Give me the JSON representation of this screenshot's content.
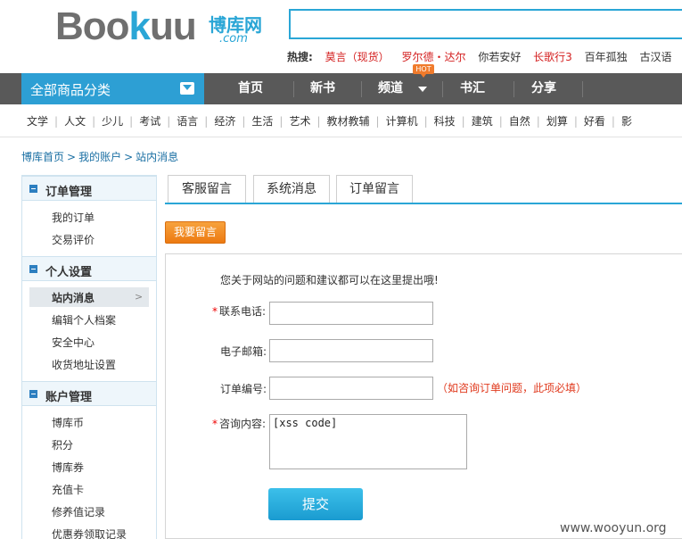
{
  "logo": {
    "word_a": "Boo",
    "word_b": "k",
    "word_c": "uu",
    "cn": "博库网",
    "com": ".com"
  },
  "search": {
    "value": ""
  },
  "hot": {
    "label": "热搜:",
    "keywords": [
      {
        "text": "莫言（现货）",
        "color": "#d42020"
      },
      {
        "text": "罗尔德・达尔",
        "color": "#d42020"
      },
      {
        "text": "你若安好",
        "color": "#333333"
      },
      {
        "text": "长歌行3",
        "color": "#d42020"
      },
      {
        "text": "百年孤独",
        "color": "#333333"
      },
      {
        "text": "古汉语",
        "color": "#333333"
      }
    ]
  },
  "nav": {
    "all_categories": "全部商品分类",
    "items": [
      "首页",
      "新书",
      "频道",
      "书汇",
      "分享"
    ],
    "hot_badge": "HOT"
  },
  "categories": [
    "文学",
    "人文",
    "少儿",
    "考试",
    "语言",
    "经济",
    "生活",
    "艺术",
    "教材教辅",
    "计算机",
    "科技",
    "建筑",
    "自然",
    "划算",
    "好看",
    "影"
  ],
  "breadcrumb": [
    "博库首页",
    "我的账户",
    "站内消息"
  ],
  "sidebar": {
    "sections": [
      {
        "title": "订单管理",
        "items": [
          "我的订单",
          "交易评价"
        ]
      },
      {
        "title": "个人设置",
        "items": [
          "站内消息",
          "编辑个人档案",
          "安全中心",
          "收货地址设置"
        ]
      },
      {
        "title": "账户管理",
        "items": [
          "博库币",
          "积分",
          "博库券",
          "充值卡",
          "修养值记录",
          "优惠券领取记录"
        ]
      }
    ]
  },
  "tabs": [
    "客服留言",
    "系统消息",
    "订单留言"
  ],
  "leave_message_button": "我要留言",
  "form": {
    "intro": "您关于网站的问题和建议都可以在这里提出哦!",
    "phone_label": "联系电话:",
    "email_label": "电子邮箱:",
    "order_label": "订单编号:",
    "order_hint": "（如咨询订单问题，此项必填）",
    "content_label": "咨询内容:",
    "content_value": "[xss code]",
    "required_mark": "*",
    "submit": "提交"
  },
  "watermark": "www.wooyun.org",
  "colors": {
    "accent": "#2aa6d6",
    "nav_bg": "#595959",
    "orange": "#ec7a12",
    "hint_red": "#e03a1e"
  }
}
